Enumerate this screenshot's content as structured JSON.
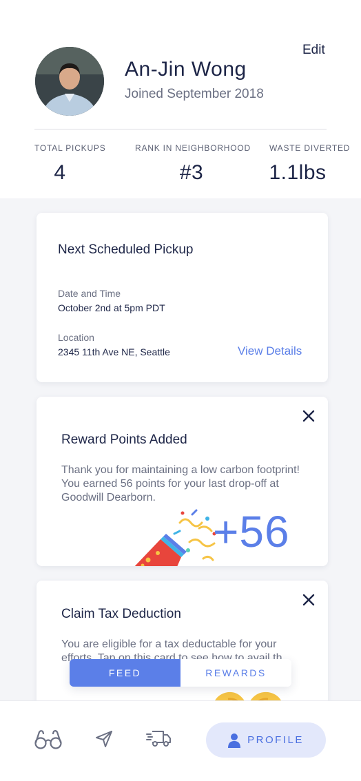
{
  "profile": {
    "edit_label": "Edit",
    "name": "An-Jin Wong",
    "joined": "Joined September 2018",
    "avatar_icon": "user-photo"
  },
  "stats": [
    {
      "label": "TOTAL PICKUPS",
      "value": "4"
    },
    {
      "label": "RANK IN NEIGHBORHOOD",
      "value": "#3"
    },
    {
      "label": "WASTE DIVERTED",
      "value": "1.1lbs"
    }
  ],
  "pickup_card": {
    "title": "Next Scheduled Pickup",
    "datetime_label": "Date and Time",
    "datetime_value": "October 2nd at 5pm PDT",
    "location_label": "Location",
    "location_value": "2345 11th Ave NE, Seattle",
    "link_label": "View Details"
  },
  "reward_card": {
    "title": "Reward Points Added",
    "body": "Thank you for maintaining a low carbon footprint! You earned 56 points for your last drop-off at Goodwill Dearborn.",
    "points": "+56",
    "close_icon": "close-icon",
    "illustration": "party-popper"
  },
  "tax_card": {
    "title": "Claim Tax Deduction",
    "body": "You are eligible for a tax deductable for your efforts. Tap on this card to see how to avail th",
    "close_icon": "close-icon",
    "illustration": "gift-box"
  },
  "segment": {
    "feed_label": "FEED",
    "rewards_label": "REWARDS",
    "selected": "FEED"
  },
  "nav": {
    "items": [
      "binoculars-icon",
      "send-icon",
      "truck-icon",
      "person-icon"
    ],
    "profile_label": "PROFILE",
    "active": "PROFILE"
  },
  "colors": {
    "accent": "#5b7fe8",
    "text_dark": "#1d2547",
    "text_muted": "#6b7083",
    "background": "#f4f5f8",
    "pill_bg": "#e3e8fb"
  }
}
